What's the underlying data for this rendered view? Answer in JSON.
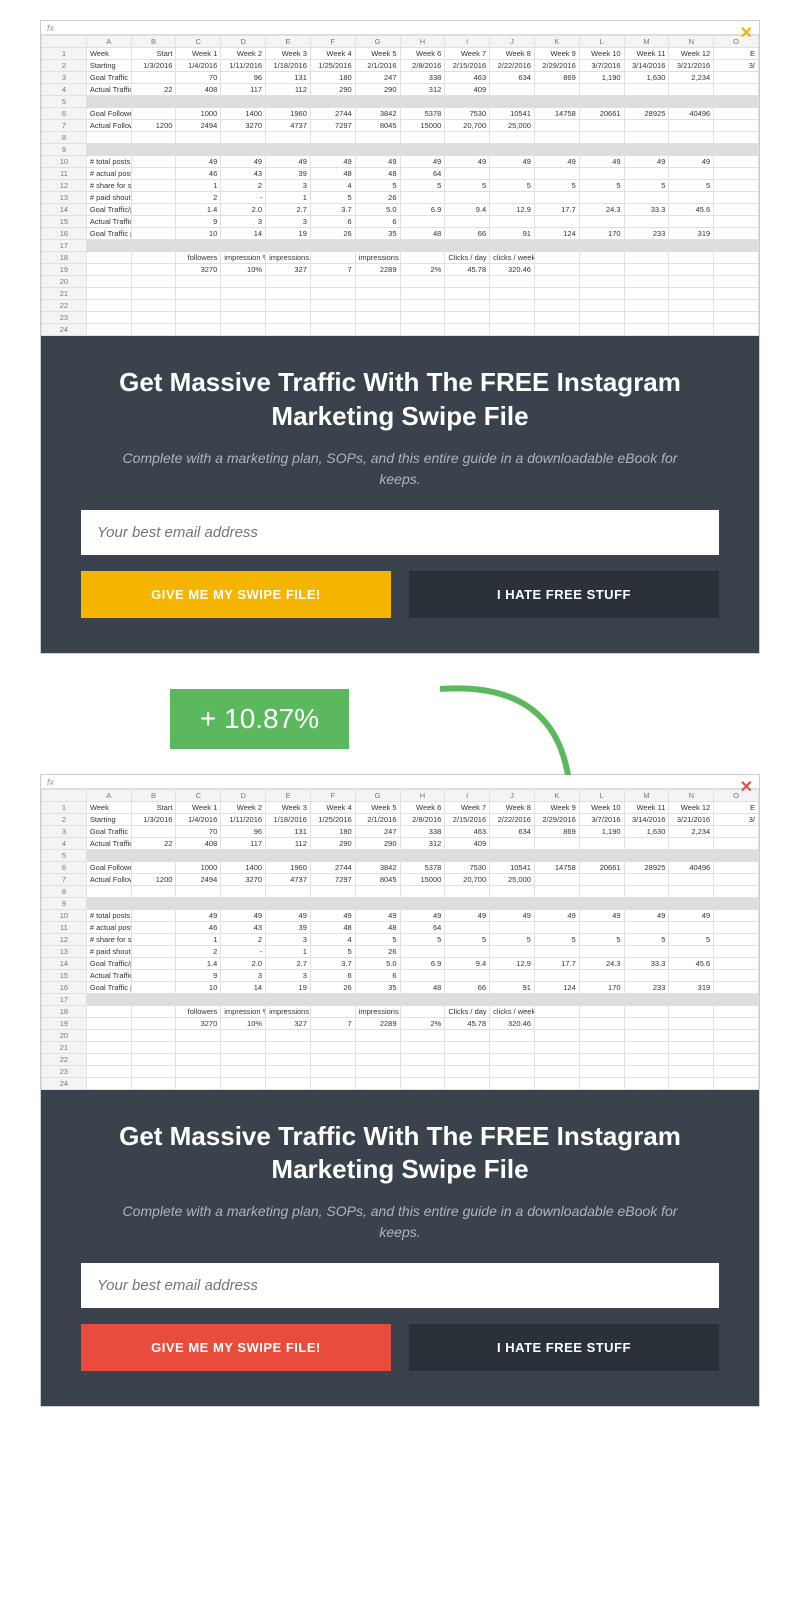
{
  "spreadsheet": {
    "fx": "fx",
    "columns": [
      "",
      "A",
      "B",
      "C",
      "D",
      "E",
      "F",
      "G",
      "H",
      "I",
      "J",
      "K",
      "L",
      "M",
      "N",
      "O"
    ],
    "rowLabels": {
      "1": "Week",
      "2": "Starting",
      "3": "Goal Traffic",
      "4": "Actual Traffic",
      "5": "",
      "6": "Goal Followers",
      "7": "Actual Followers",
      "8": "",
      "9": "",
      "10": "# total posts",
      "11": "# actual posts",
      "12": "# share for shares",
      "13": "# paid shoutouts",
      "14": "Goal Traffic/post",
      "15": "Actual Traffic/post",
      "16": "Goal Traffic per CTA post",
      "17": "",
      "18": "",
      "19": ""
    },
    "weeks": [
      "Start",
      "Week 1",
      "Week 2",
      "Week 3",
      "Week 4",
      "Week 5",
      "Week 6",
      "Week 7",
      "Week 8",
      "Week 9",
      "Week 10",
      "Week 11",
      "Week 12",
      "E"
    ],
    "dates": [
      "1/3/2016",
      "1/4/2016",
      "1/11/2016",
      "1/18/2016",
      "1/25/2016",
      "2/1/2016",
      "2/8/2016",
      "2/15/2016",
      "2/22/2016",
      "2/29/2016",
      "3/7/2016",
      "3/14/2016",
      "3/21/2016",
      "3/"
    ],
    "goalTraffic": [
      "",
      "70",
      "96",
      "131",
      "180",
      "247",
      "338",
      "463",
      "634",
      "869",
      "1,190",
      "1,630",
      "2,234",
      ""
    ],
    "actualTraffic": [
      "22",
      "408",
      "117",
      "112",
      "290",
      "290",
      "312",
      "409",
      "",
      "",
      "",
      "",
      "",
      ""
    ],
    "goalFollowers": [
      "",
      "1000",
      "1400",
      "1960",
      "2744",
      "3842",
      "5378",
      "7530",
      "10541",
      "14758",
      "20661",
      "28925",
      "40496",
      ""
    ],
    "actualFollowers": [
      "1200",
      "2494",
      "3270",
      "4737",
      "7297",
      "8045",
      "15000",
      "20,700",
      "25,000",
      "",
      "",
      "",
      "",
      ""
    ],
    "totalPosts": [
      "",
      "49",
      "49",
      "49",
      "49",
      "49",
      "49",
      "49",
      "49",
      "49",
      "49",
      "49",
      "49",
      ""
    ],
    "actualPosts": [
      "",
      "46",
      "43",
      "39",
      "48",
      "48",
      "64",
      "",
      "",
      "",
      "",
      "",
      "",
      ""
    ],
    "shareForShares": [
      "",
      "1",
      "2",
      "3",
      "4",
      "5",
      "5",
      "5",
      "5",
      "5",
      "5",
      "5",
      "5",
      ""
    ],
    "paidShoutouts": [
      "",
      "2",
      "-",
      "1",
      "5",
      "26",
      "",
      "",
      "",
      "",
      "",
      "",
      "",
      ""
    ],
    "goalTrafficPost": [
      "",
      "1.4",
      "2.0",
      "2.7",
      "3.7",
      "5.0",
      "6.9",
      "9.4",
      "12.9",
      "17.7",
      "24.3",
      "33.3",
      "45.6",
      ""
    ],
    "actualTrafficPost": [
      "",
      "9",
      "3",
      "3",
      "6",
      "6",
      "",
      "",
      "",
      "",
      "",
      "",
      "",
      ""
    ],
    "goalTrafficCTA": [
      "",
      "10",
      "14",
      "19",
      "26",
      "35",
      "48",
      "66",
      "91",
      "124",
      "170",
      "233",
      "319",
      ""
    ],
    "row18Labels": [
      "",
      "followers",
      "impression %",
      "impressions / posts / day",
      "",
      "impressions / CTR",
      "",
      "Clicks / day",
      "clicks / week",
      "",
      "",
      "",
      "",
      ""
    ],
    "row19": [
      "",
      "3270",
      "10%",
      "327",
      "7",
      "2289",
      "2%",
      "45.78",
      "320.46",
      "",
      "",
      "",
      "",
      ""
    ]
  },
  "optin": {
    "heading": "Get Massive Traffic With The FREE Instagram Marketing Swipe File",
    "sub": "Complete with a marketing plan, SOPs, and this entire guide in a downloadable eBook for keeps.",
    "placeholder": "Your best email address",
    "primary": "GIVE ME MY SWIPE FILE!",
    "secondary": "I HATE FREE STUFF"
  },
  "comparison": {
    "badge": "+ 10.87%"
  },
  "closeA": "✕",
  "closeB": "✕"
}
